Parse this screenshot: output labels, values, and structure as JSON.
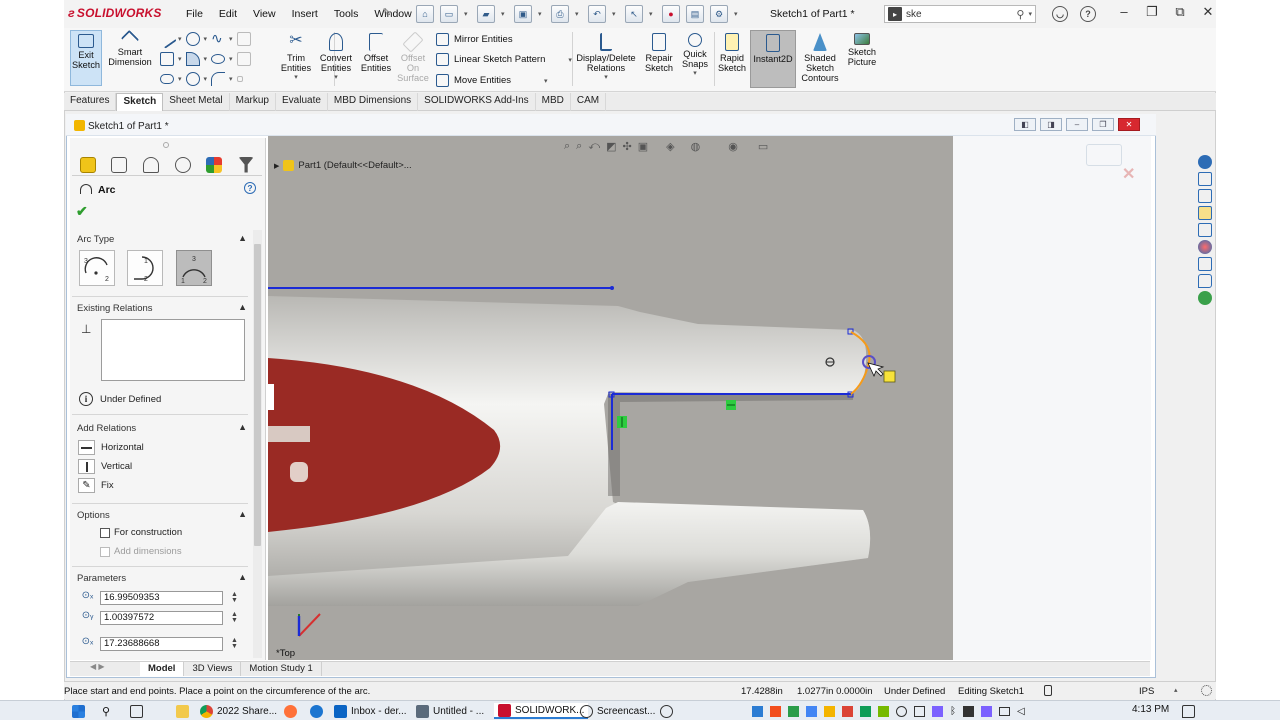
{
  "app": {
    "logo": "SOLIDWORKS",
    "document_title": "Sketch1 of Part1 *",
    "menu": [
      "File",
      "Edit",
      "View",
      "Insert",
      "Tools",
      "Window"
    ],
    "search_value": "ske"
  },
  "command_manager": {
    "exit_sketch": "Exit Sketch",
    "smart_dimension": "Smart Dimension",
    "trim_entities": "Trim Entities",
    "convert_entities": "Convert Entities",
    "offset_entities": "Offset Entities",
    "offset_on_surface": "Offset On Surface",
    "mirror_entities": "Mirror Entities",
    "linear_sketch_pattern": "Linear Sketch Pattern",
    "move_entities": "Move Entities",
    "display_delete_relations": "Display/Delete Relations",
    "repair_sketch": "Repair Sketch",
    "quick_snaps": "Quick Snaps",
    "rapid_sketch": "Rapid Sketch",
    "instant2d": "Instant2D",
    "shaded_sketch_contours": "Shaded Sketch Contours",
    "sketch_picture": "Sketch Picture"
  },
  "tabs": [
    "Features",
    "Sketch",
    "Sheet Metal",
    "Markup",
    "Evaluate",
    "MBD Dimensions",
    "SOLIDWORKS Add-Ins",
    "MBD",
    "CAM"
  ],
  "active_tab": "Sketch",
  "document_window": {
    "tab_label": "Sketch1 of Part1 *",
    "tree_label": "Part1  (Default<<Default>..."
  },
  "property_manager": {
    "title": "Arc",
    "arc_type": {
      "header": "Arc Type",
      "options": [
        "Centerpoint Arc",
        "Tangent Arc",
        "3 Point Arc"
      ],
      "selected": "3 Point Arc"
    },
    "existing_relations": {
      "header": "Existing Relations",
      "status": "Under Defined"
    },
    "add_relations": {
      "header": "Add Relations",
      "items": [
        "Horizontal",
        "Vertical",
        "Fix"
      ]
    },
    "options": {
      "header": "Options",
      "for_construction": "For construction",
      "add_dimensions": "Add dimensions"
    },
    "parameters": {
      "header": "Parameters",
      "values": [
        "16.99509353",
        "1.00397572",
        "17.23688668"
      ]
    }
  },
  "viewport": {
    "view_label": "*Top"
  },
  "model_tabs": [
    "Model",
    "3D Views",
    "Motion Study 1"
  ],
  "status_bar": {
    "message": "Place start and end points.  Place a point on the circumference of the arc.",
    "x": "17.4288in",
    "y": "1.0277in  0.0000in",
    "definition": "Under Defined",
    "editing": "Editing Sketch1",
    "units": "IPS"
  },
  "taskbar": {
    "items": [
      "2022 Share...",
      "Inbox - der...",
      "Untitled - ...",
      "SOLIDWORK...",
      "Screencast..."
    ],
    "active": "SOLIDWORK...",
    "clock": "4:13 PM"
  },
  "colors": {
    "sketch_line": "#1b2bd6",
    "arc_preview": "#f59b1a",
    "relation_marker": "#2ecc40",
    "background_gray": "#a8a6a2",
    "part_red": "#9a2a24",
    "accent_blue": "#2b7cd3"
  }
}
